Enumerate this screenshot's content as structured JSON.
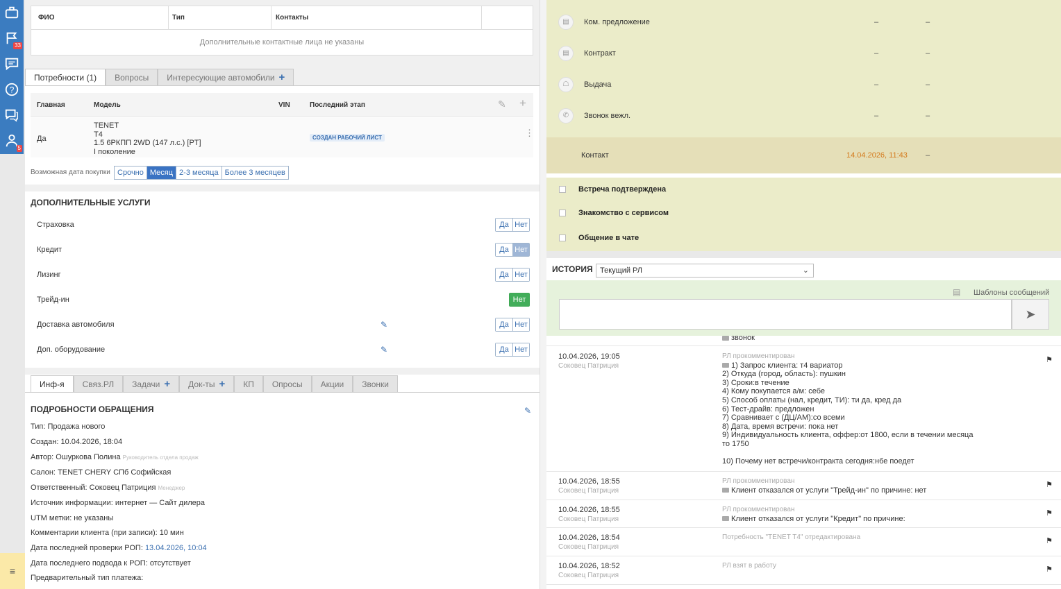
{
  "sidebar": {
    "badges": {
      "flags": "33",
      "manager": "5"
    }
  },
  "contacts": {
    "headers": [
      "ФИО",
      "Тип",
      "Контакты"
    ],
    "empty": "Дополнительные контактные лица не указаны"
  },
  "needs_tabs": {
    "needs": "Потребности (1)",
    "questions": "Вопросы",
    "cars": "Интересующие автомобили"
  },
  "needs_table": {
    "headers": {
      "main": "Главная",
      "model": "Модель",
      "vin": "VIN",
      "stage": "Последний этап"
    },
    "row": {
      "main": "Да",
      "model_lines": [
        "TENET",
        "T4",
        "1.5 6РКПП 2WD (147 л.с.) [PT]",
        "I поколение"
      ],
      "vin": "",
      "stage": "СОЗДАН РАБОЧИЙ ЛИСТ"
    }
  },
  "purchase": {
    "label": "Возможная дата покупки",
    "options": [
      "Срочно",
      "Месяц",
      "2-3 месяца",
      "Более 3 месяцев"
    ],
    "selected": "Месяц"
  },
  "services": {
    "title": "ДОПОЛНИТЕЛЬНЫЕ УСЛУГИ",
    "yes": "Да",
    "no": "Нет",
    "items": [
      "Страховка",
      "Кредит",
      "Лизинг",
      "Трейд-ин",
      "Доставка автомобиля",
      "Доп. оборудование"
    ]
  },
  "bottom_tabs": {
    "info": "Инф-я",
    "rl": "Связ.РЛ",
    "tasks": "Задачи",
    "docs": "Док-ты",
    "kp": "КП",
    "polls": "Опросы",
    "promo": "Акции",
    "calls": "Звонки"
  },
  "details": {
    "title": "ПОДРОБНОСТИ ОБРАЩЕНИЯ",
    "type": "Тип: Продажа нового",
    "created": "Создан: 10.04.2026, 18:04",
    "author": "Автор: Ошуркова Полина",
    "author_role": "Руководитель отдела продаж",
    "salon": "Салон: TENET CHERY СПб Софийская",
    "responsible": "Ответственный: Соковец Патриция",
    "responsible_role": "Менеджер",
    "source": "Источник информации: интернет — Сайт дилера",
    "utm": "UTM метки: не указаны",
    "comments": "Комментарии клиента (при записи): 10 мин",
    "last_check_label": "Дата последней проверки РОП: ",
    "last_check_value": "13.04.2026, 10:04",
    "last_summary": "Дата последнего подвода к РОП: отсутствует",
    "payment": "Предварительный тип платежа:"
  },
  "stages": [
    {
      "name": "Ком. предложение",
      "a": "–",
      "b": "–"
    },
    {
      "name": "Контракт",
      "a": "–",
      "b": "–"
    },
    {
      "name": "Выдача",
      "a": "–",
      "b": "–"
    },
    {
      "name": "Звонок вежл.",
      "a": "–",
      "b": "–"
    }
  ],
  "contact_stage": {
    "name": "Контакт",
    "date": "14.04.2026, 11:43",
    "b": "–"
  },
  "checks": [
    "Встреча подтверждена",
    "Знакомство с сервисом",
    "Общение в чате"
  ],
  "history": {
    "title": "ИСТОРИЯ",
    "filter": "Текущий РЛ",
    "templates": "Шаблоны сообщений",
    "partial": "звонок",
    "entries": [
      {
        "date": "10.04.2026, 19:05",
        "who": "Соковец Патриция",
        "type": "РЛ прокомментирован",
        "text": "1) Запрос клиента: т4 вариатор\n2) Откуда (город, область): пушкин\n3) Сроки:в течение\n4) Кому покупается а/м: себе\n5) Способ оплаты (нал, кредит, ТИ): ти да, кред да\n6) Тест-драйв: предложен\n7) Сравнивает с (ДЦ/АМ):со всеми\n8) Дата, время встречи: пока нет\n9) Индивидуальность клиента, оффер:от 1800, если в течении месяца\nто 1750\n\n10) Почему нет встречи/контракта сегодня:нбе поедет"
      },
      {
        "date": "10.04.2026, 18:55",
        "who": "Соковец Патриция",
        "type": "РЛ прокомментирован",
        "text": "Клиент отказался от услуги \"Трейд-ин\" по причине: нет"
      },
      {
        "date": "10.04.2026, 18:55",
        "who": "Соковец Патриция",
        "type": "РЛ прокомментирован",
        "text": "Клиент отказался от услуги \"Кредит\" по причине:"
      },
      {
        "date": "10.04.2026, 18:54",
        "who": "Соковец Патриция",
        "type": "Потребность \"TENET T4\" отредактирована",
        "text": ""
      },
      {
        "date": "10.04.2026, 18:52",
        "who": "Соковец Патриция",
        "type": "РЛ взят в работу",
        "text": ""
      }
    ]
  }
}
